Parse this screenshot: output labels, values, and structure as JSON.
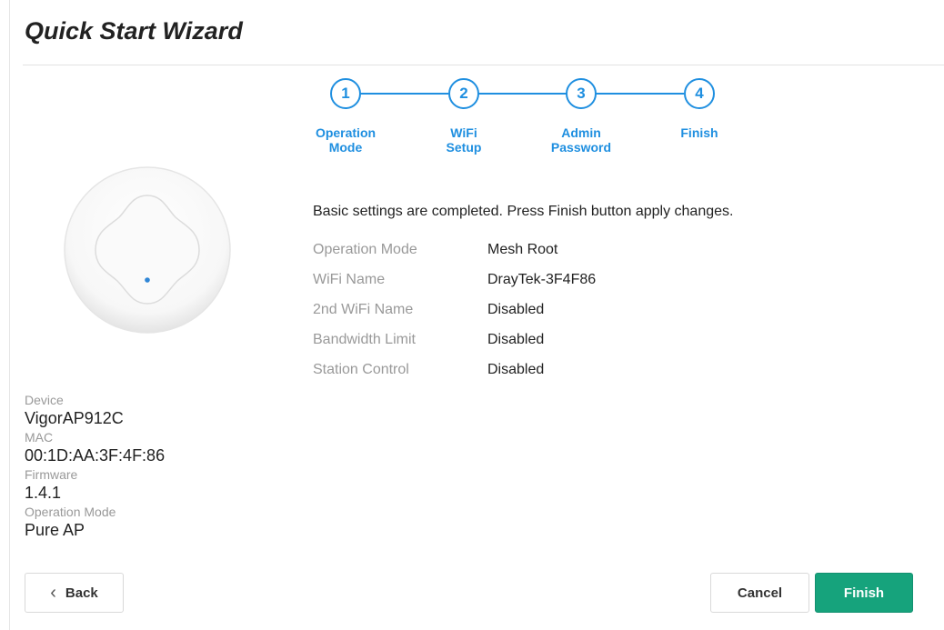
{
  "header": {
    "title": "Quick Start Wizard"
  },
  "steps": [
    {
      "number": "1",
      "label": "Operation\nMode"
    },
    {
      "number": "2",
      "label": "WiFi\nSetup"
    },
    {
      "number": "3",
      "label": "Admin\nPassword"
    },
    {
      "number": "4",
      "label": "Finish"
    }
  ],
  "device_info": {
    "device_label": "Device",
    "device_value": "VigorAP912C",
    "mac_label": "MAC",
    "mac_value": "00:1D:AA:3F:4F:86",
    "firmware_label": "Firmware",
    "firmware_value": "1.4.1",
    "opmode_label": "Operation Mode",
    "opmode_value": "Pure AP"
  },
  "summary": {
    "message": "Basic settings are completed. Press Finish button apply changes.",
    "rows": [
      {
        "label": "Operation Mode",
        "value": "Mesh Root"
      },
      {
        "label": "WiFi Name",
        "value": "DrayTek-3F4F86"
      },
      {
        "label": "2nd WiFi Name",
        "value": "Disabled"
      },
      {
        "label": "Bandwidth Limit",
        "value": "Disabled"
      },
      {
        "label": "Station Control",
        "value": "Disabled"
      }
    ]
  },
  "buttons": {
    "back": "Back",
    "cancel": "Cancel",
    "finish": "Finish"
  },
  "colors": {
    "accent": "#1f8fe0",
    "finish_button": "#16a37c"
  },
  "icons": {
    "back": "chevron-left-icon",
    "device": "access-point-device-icon"
  }
}
